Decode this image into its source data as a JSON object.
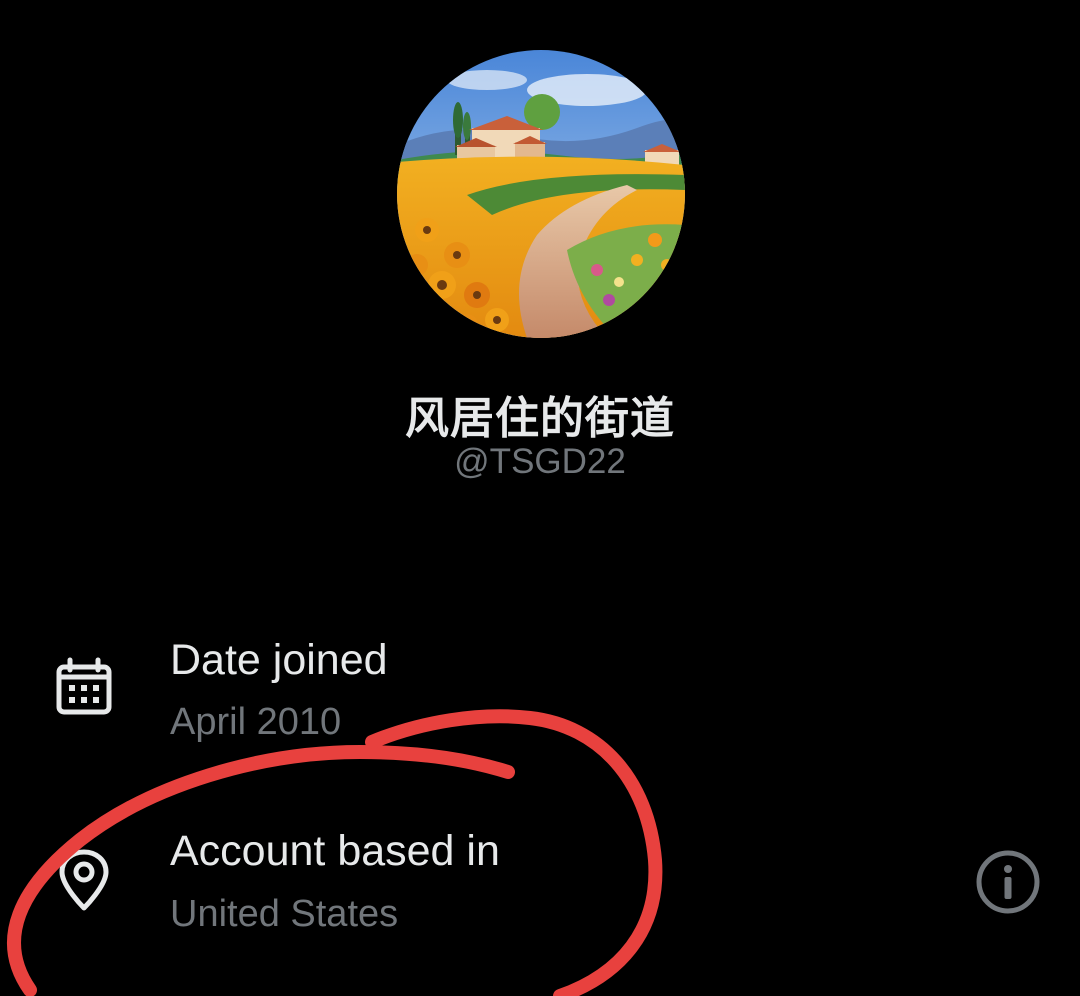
{
  "profile": {
    "display_name": "风居住的街道",
    "handle": "@TSGD22",
    "avatar_icon": "landscape-painting-avatar"
  },
  "about": {
    "date_joined": {
      "icon": "calendar-icon",
      "title": "Date joined",
      "value": "April 2010"
    },
    "account_based_in": {
      "icon": "location-pin-icon",
      "title": "Account based in",
      "value": "United States",
      "info_icon": "info-icon"
    }
  },
  "colors": {
    "background": "#000000",
    "primary_text": "#e7e9ea",
    "secondary_text": "#71767b",
    "annotation_red": "#e8413e"
  }
}
